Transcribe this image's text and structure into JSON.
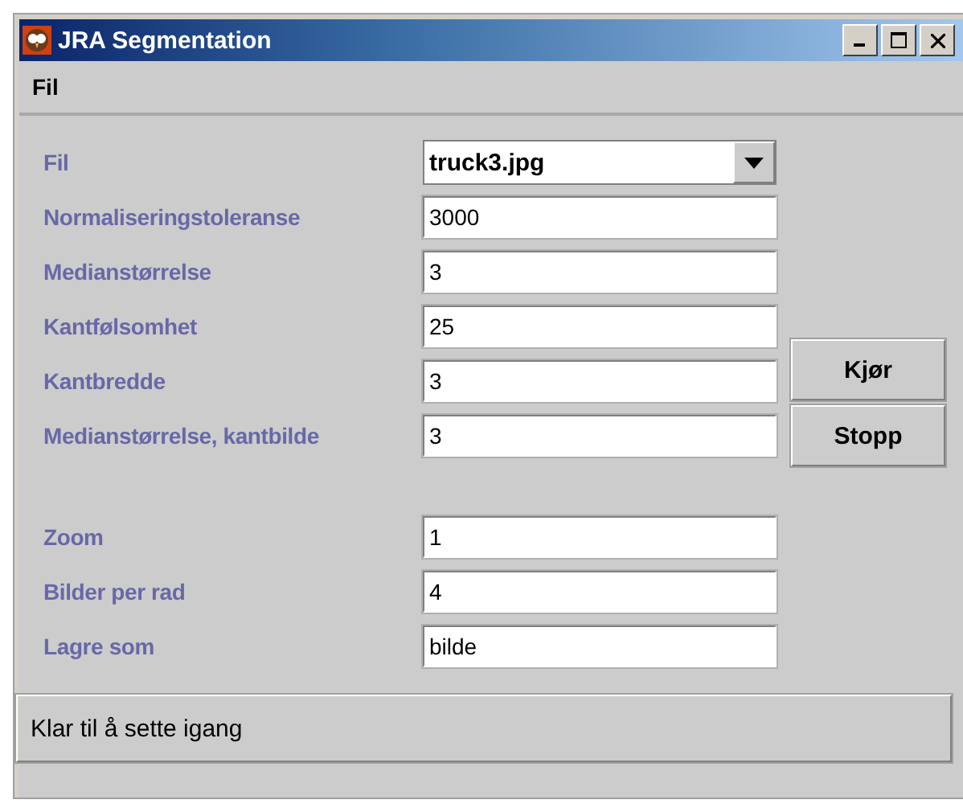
{
  "window": {
    "title": "JRA Segmentation"
  },
  "menu": [
    "Fil"
  ],
  "settings": [
    {
      "kind": "combo",
      "label": "Fil",
      "value": "truck3.jpg"
    },
    {
      "kind": "text",
      "label": "Normaliseringstoleranse",
      "value": "3000"
    },
    {
      "kind": "text",
      "label": "Medianstørrelse",
      "value": "3"
    },
    {
      "kind": "text",
      "label": "Kantfølsomhet",
      "value": "25"
    },
    {
      "kind": "text",
      "label": "Kantbredde",
      "value": "3"
    },
    {
      "kind": "text",
      "label": "Medianstørrelse, kantbilde",
      "value": "3"
    }
  ],
  "buttons": [
    "Kjør",
    "Stopp"
  ],
  "output_settings": [
    {
      "kind": "text",
      "label": "Zoom",
      "value": "1"
    },
    {
      "kind": "text",
      "label": "Bilder per rad",
      "value": "4"
    },
    {
      "kind": "text",
      "label": "Lagre som",
      "value": "bilde"
    }
  ],
  "status_bar": "Klar til å sette igang"
}
